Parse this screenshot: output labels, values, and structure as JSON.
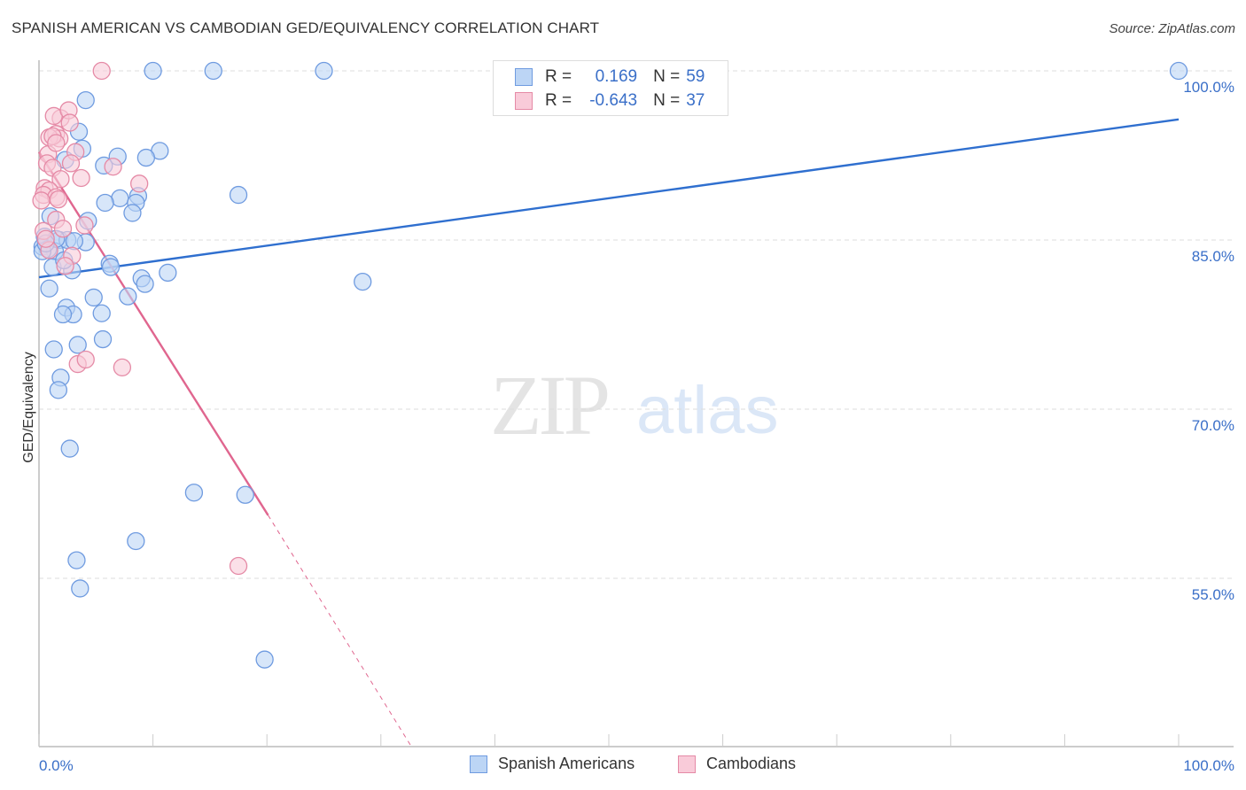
{
  "title": "SPANISH AMERICAN VS CAMBODIAN GED/EQUIVALENCY CORRELATION CHART",
  "source": "Source: ZipAtlas.com",
  "watermark": {
    "zip": "ZIP",
    "atlas": "atlas"
  },
  "legend": {
    "rows": [
      {
        "r_label": "R =",
        "r_value": "0.169",
        "n_label": "N =",
        "n_value": "59",
        "color": "#a9c8f2",
        "border": "#6f9be0"
      },
      {
        "r_label": "R =",
        "r_value": "-0.643",
        "n_label": "N =",
        "n_value": "37",
        "color": "#f8c2d2",
        "border": "#e58aa6"
      }
    ]
  },
  "bottom_legend": [
    {
      "label": "Spanish Americans",
      "color": "#bcd5f5",
      "border": "#6f9be0"
    },
    {
      "label": "Cambodians",
      "color": "#f9cbd9",
      "border": "#e58aa6"
    }
  ],
  "chart_data": {
    "type": "scatter",
    "title": "SPANISH AMERICAN VS CAMBODIAN GED/EQUIVALENCY CORRELATION CHART",
    "xlabel": "",
    "ylabel": "GED/Equivalency",
    "xlim": [
      0,
      100
    ],
    "ylim": [
      40.2,
      100.6
    ],
    "x_tick_labels": [
      "0.0%",
      "100.0%"
    ],
    "y_ticks": [
      100,
      85,
      70,
      55
    ],
    "y_tick_labels": [
      "100.0%",
      "85.0%",
      "70.0%",
      "55.0%"
    ],
    "grid": true,
    "legend_position": "top-center",
    "series": [
      {
        "name": "Spanish Americans",
        "color": "#6f9be0",
        "fill": "#bcd5f5",
        "R": 0.169,
        "N": 59,
        "trend": {
          "x": [
            0,
            100
          ],
          "y": [
            81.7,
            95.7
          ],
          "color": "#2f6fcf"
        },
        "points": [
          [
            10.0,
            100.0
          ],
          [
            15.3,
            100.0
          ],
          [
            25.0,
            100.0
          ],
          [
            100.0,
            100.0
          ],
          [
            4.1,
            97.4
          ],
          [
            3.5,
            94.6
          ],
          [
            3.8,
            93.1
          ],
          [
            10.6,
            92.9
          ],
          [
            6.9,
            92.4
          ],
          [
            2.3,
            92.1
          ],
          [
            9.4,
            92.3
          ],
          [
            5.7,
            91.6
          ],
          [
            17.5,
            89.0
          ],
          [
            7.1,
            88.7
          ],
          [
            8.7,
            88.9
          ],
          [
            5.8,
            88.3
          ],
          [
            8.5,
            88.3
          ],
          [
            8.2,
            87.4
          ],
          [
            1.0,
            87.1
          ],
          [
            4.3,
            86.7
          ],
          [
            0.5,
            85.3
          ],
          [
            1.8,
            85.0
          ],
          [
            2.5,
            85.0
          ],
          [
            4.1,
            84.8
          ],
          [
            0.3,
            84.4
          ],
          [
            1.4,
            84.0
          ],
          [
            0.8,
            84.2
          ],
          [
            3.1,
            84.9
          ],
          [
            0.3,
            84.0
          ],
          [
            6.2,
            82.9
          ],
          [
            6.3,
            82.6
          ],
          [
            2.9,
            82.3
          ],
          [
            1.2,
            82.6
          ],
          [
            11.3,
            82.1
          ],
          [
            9.0,
            81.6
          ],
          [
            9.3,
            81.1
          ],
          [
            28.4,
            81.3
          ],
          [
            0.9,
            80.7
          ],
          [
            4.8,
            79.9
          ],
          [
            2.4,
            79.0
          ],
          [
            3.0,
            78.4
          ],
          [
            5.5,
            78.5
          ],
          [
            2.1,
            78.4
          ],
          [
            5.6,
            76.2
          ],
          [
            3.4,
            75.7
          ],
          [
            1.3,
            75.3
          ],
          [
            1.9,
            72.8
          ],
          [
            1.7,
            71.7
          ],
          [
            2.7,
            66.5
          ],
          [
            13.6,
            62.6
          ],
          [
            18.1,
            62.4
          ],
          [
            8.5,
            58.3
          ],
          [
            3.3,
            56.6
          ],
          [
            3.6,
            54.1
          ],
          [
            19.8,
            47.8
          ],
          [
            1.5,
            85.1
          ],
          [
            0.6,
            84.7
          ],
          [
            7.8,
            80.0
          ],
          [
            2.2,
            83.2
          ]
        ]
      },
      {
        "name": "Cambodians",
        "color": "#e58aa6",
        "fill": "#f9cbd9",
        "R": -0.643,
        "N": 37,
        "trend": {
          "x": [
            0,
            20.1
          ],
          "y": [
            92.8,
            60.6
          ],
          "dashed_to": {
            "x": 32.6,
            "y": 40.2
          },
          "color": "#e0668f"
        },
        "points": [
          [
            5.5,
            100.0
          ],
          [
            1.9,
            95.8
          ],
          [
            1.3,
            96.0
          ],
          [
            2.6,
            96.5
          ],
          [
            2.7,
            95.4
          ],
          [
            1.5,
            94.4
          ],
          [
            1.8,
            94.0
          ],
          [
            0.9,
            94.1
          ],
          [
            1.2,
            94.2
          ],
          [
            3.2,
            92.8
          ],
          [
            0.8,
            92.6
          ],
          [
            1.5,
            93.6
          ],
          [
            0.7,
            91.8
          ],
          [
            2.8,
            91.8
          ],
          [
            6.5,
            91.5
          ],
          [
            1.2,
            91.4
          ],
          [
            3.7,
            90.5
          ],
          [
            1.9,
            90.4
          ],
          [
            8.8,
            90.0
          ],
          [
            0.5,
            89.6
          ],
          [
            0.9,
            89.4
          ],
          [
            0.4,
            89.0
          ],
          [
            1.5,
            88.8
          ],
          [
            0.2,
            88.5
          ],
          [
            1.7,
            88.6
          ],
          [
            1.5,
            86.8
          ],
          [
            4.0,
            86.3
          ],
          [
            2.1,
            86.0
          ],
          [
            0.4,
            85.8
          ],
          [
            2.9,
            83.6
          ],
          [
            2.3,
            82.7
          ],
          [
            0.9,
            84.1
          ],
          [
            3.4,
            74.0
          ],
          [
            4.1,
            74.4
          ],
          [
            7.3,
            73.7
          ],
          [
            17.5,
            56.1
          ],
          [
            0.6,
            85.1
          ]
        ]
      }
    ]
  }
}
